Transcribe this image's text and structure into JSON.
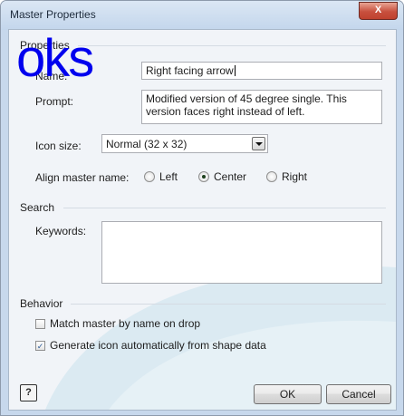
{
  "window": {
    "title": "Master Properties",
    "close_glyph": "X"
  },
  "overlay_text": "oks",
  "properties": {
    "section_label": "Properties",
    "name_label": "Name:",
    "name_value": "Right facing arrow",
    "prompt_label": "Prompt:",
    "prompt_value": "Modified version of 45 degree single. This version faces right instead of left.",
    "icon_size_label": "Icon size:",
    "icon_size_value": "Normal (32 x 32)",
    "align_label": "Align master name:",
    "align_options": [
      {
        "label": "Left",
        "selected": false
      },
      {
        "label": "Center",
        "selected": true
      },
      {
        "label": "Right",
        "selected": false
      }
    ]
  },
  "search": {
    "section_label": "Search",
    "keywords_label": "Keywords:",
    "keywords_value": ""
  },
  "behavior": {
    "section_label": "Behavior",
    "options": [
      {
        "label": "Match master by name on drop",
        "checked": false
      },
      {
        "label": "Generate icon automatically from shape data",
        "checked": true
      }
    ]
  },
  "buttons": {
    "help_glyph": "?",
    "ok": "OK",
    "cancel": "Cancel"
  },
  "colors": {
    "accent": "#0000ee",
    "frame": "#c7d8ec",
    "swoosh": "#d9eaf2"
  }
}
